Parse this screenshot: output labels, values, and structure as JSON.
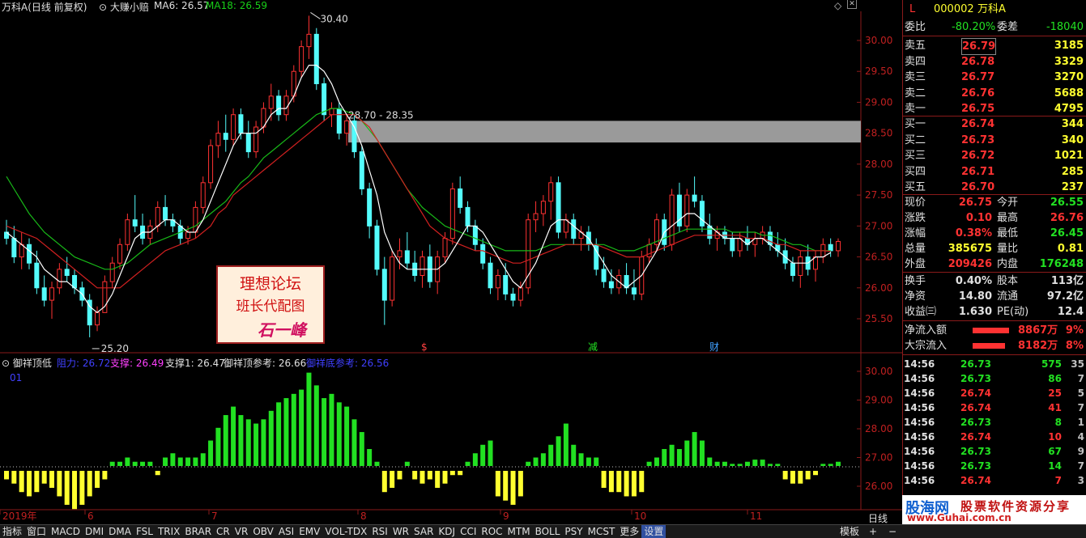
{
  "chart_header": {
    "title": "万科A(日线 前复权)",
    "indicator_name": "大赚小赔",
    "ma6": "MA6: 26.57",
    "ma18": "MA18: 26.59"
  },
  "price_axis": [
    "30.00",
    "29.50",
    "29.00",
    "28.50",
    "28.00",
    "27.50",
    "27.00",
    "26.50",
    "26.00",
    "25.50"
  ],
  "price_annotations": {
    "high": "30.40",
    "low": "25.20",
    "zone": "28.70 - 28.35"
  },
  "markers": [
    "$",
    "减",
    "财"
  ],
  "lower_header": {
    "name": "御祥顶低",
    "r": "阻力: 26.72",
    "s": "支撑: 26.49",
    "s1": "支撑1: 26.47",
    "top": "御祥顶参考: 26.66",
    "bottom": "御祥底参考: 26.56",
    "tag": "01"
  },
  "lower_axis": [
    "30.00",
    "29.00",
    "28.00",
    "27.00",
    "26.00"
  ],
  "time_axis": [
    "2019年",
    "6",
    "7",
    "8",
    "9",
    "10",
    "11"
  ],
  "watermark": {
    "line1": "理想论坛",
    "line2": "班长代配图",
    "line3": "石一峰"
  },
  "colors": {
    "up": "#ff3232",
    "down": "#54fcfc",
    "ma_white": "#ffffff",
    "ma_red": "#d02020",
    "ma_green": "#18b818",
    "bar_green": "#22e022",
    "bar_yellow": "#ffff30",
    "yellow": "#ffff30"
  },
  "chart_data": {
    "type": "candlestick",
    "ohlc": [
      [
        26.9,
        27.1,
        26.7,
        26.8
      ],
      [
        26.8,
        27.0,
        26.4,
        26.5
      ],
      [
        26.5,
        26.9,
        26.3,
        26.7
      ],
      [
        26.7,
        26.8,
        26.3,
        26.4
      ],
      [
        26.4,
        26.6,
        25.9,
        26.0
      ],
      [
        26.0,
        26.2,
        25.7,
        25.8
      ],
      [
        25.8,
        26.1,
        25.5,
        26.0
      ],
      [
        26.0,
        26.4,
        25.9,
        26.3
      ],
      [
        26.3,
        26.5,
        26.1,
        26.2
      ],
      [
        26.2,
        26.3,
        25.9,
        26.0
      ],
      [
        26.0,
        26.1,
        25.7,
        25.8
      ],
      [
        25.8,
        25.9,
        25.2,
        25.4
      ],
      [
        25.4,
        25.7,
        25.3,
        25.6
      ],
      [
        25.6,
        26.2,
        25.6,
        26.1
      ],
      [
        26.1,
        26.5,
        26.0,
        26.4
      ],
      [
        26.4,
        26.8,
        26.3,
        26.7
      ],
      [
        26.7,
        27.2,
        26.6,
        27.1
      ],
      [
        27.1,
        27.5,
        26.9,
        27.0
      ],
      [
        27.0,
        27.2,
        26.7,
        26.8
      ],
      [
        26.8,
        27.1,
        26.7,
        27.0
      ],
      [
        27.0,
        27.4,
        26.9,
        27.3
      ],
      [
        27.3,
        27.5,
        27.0,
        27.1
      ],
      [
        27.1,
        27.2,
        26.9,
        27.0
      ],
      [
        27.0,
        27.1,
        26.7,
        26.8
      ],
      [
        26.8,
        27.0,
        26.7,
        26.9
      ],
      [
        26.9,
        27.4,
        26.8,
        27.3
      ],
      [
        27.3,
        27.8,
        27.2,
        27.7
      ],
      [
        27.7,
        28.4,
        27.6,
        28.3
      ],
      [
        28.3,
        28.7,
        28.1,
        28.5
      ],
      [
        28.5,
        28.8,
        28.2,
        28.4
      ],
      [
        28.4,
        28.9,
        28.3,
        28.8
      ],
      [
        28.8,
        28.9,
        28.4,
        28.5
      ],
      [
        28.5,
        28.7,
        28.1,
        28.2
      ],
      [
        28.2,
        28.7,
        28.1,
        28.6
      ],
      [
        28.6,
        29.0,
        28.5,
        28.9
      ],
      [
        28.9,
        29.3,
        28.7,
        29.1
      ],
      [
        29.1,
        29.2,
        28.7,
        28.8
      ],
      [
        28.8,
        29.2,
        28.7,
        29.1
      ],
      [
        29.1,
        29.6,
        29.0,
        29.5
      ],
      [
        29.5,
        30.0,
        29.4,
        29.9
      ],
      [
        29.9,
        30.4,
        29.7,
        30.1
      ],
      [
        30.1,
        30.2,
        29.2,
        29.3
      ],
      [
        29.3,
        29.4,
        28.7,
        28.8
      ],
      [
        28.8,
        29.0,
        28.6,
        28.9
      ],
      [
        28.9,
        29.0,
        28.4,
        28.5
      ],
      [
        28.5,
        28.8,
        28.3,
        28.7
      ],
      [
        28.7,
        28.8,
        28.1,
        28.2
      ],
      [
        28.2,
        28.3,
        27.5,
        27.6
      ],
      [
        27.6,
        27.7,
        26.8,
        27.0
      ],
      [
        27.0,
        27.1,
        26.2,
        26.3
      ],
      [
        26.3,
        26.5,
        25.4,
        25.8
      ],
      [
        25.8,
        26.6,
        25.7,
        26.5
      ],
      [
        26.5,
        26.8,
        26.3,
        26.6
      ],
      [
        26.6,
        26.9,
        26.3,
        26.4
      ],
      [
        26.4,
        26.6,
        26.1,
        26.2
      ],
      [
        26.2,
        26.6,
        26.0,
        26.5
      ],
      [
        26.5,
        26.7,
        26.0,
        26.1
      ],
      [
        26.1,
        26.6,
        25.9,
        26.5
      ],
      [
        26.5,
        26.9,
        26.4,
        26.8
      ],
      [
        26.8,
        27.7,
        26.7,
        27.6
      ],
      [
        27.6,
        27.8,
        27.2,
        27.3
      ],
      [
        27.3,
        27.4,
        26.9,
        27.0
      ],
      [
        27.0,
        27.1,
        26.6,
        26.7
      ],
      [
        26.7,
        26.8,
        26.3,
        26.4
      ],
      [
        26.4,
        26.5,
        25.9,
        26.0
      ],
      [
        26.0,
        26.3,
        25.8,
        26.2
      ],
      [
        26.2,
        26.4,
        25.8,
        25.9
      ],
      [
        25.9,
        26.0,
        25.7,
        25.8
      ],
      [
        25.8,
        26.1,
        25.7,
        26.0
      ],
      [
        26.0,
        27.2,
        25.9,
        27.1
      ],
      [
        27.1,
        27.4,
        26.9,
        27.2
      ],
      [
        27.2,
        27.5,
        27.0,
        27.4
      ],
      [
        27.4,
        27.8,
        27.1,
        27.7
      ],
      [
        27.7,
        27.8,
        26.8,
        26.9
      ],
      [
        26.9,
        27.2,
        26.8,
        27.1
      ],
      [
        27.1,
        27.2,
        26.7,
        26.8
      ],
      [
        26.8,
        27.0,
        26.6,
        26.9
      ],
      [
        26.9,
        27.0,
        26.6,
        26.7
      ],
      [
        26.7,
        26.8,
        26.2,
        26.3
      ],
      [
        26.3,
        26.5,
        26.0,
        26.1
      ],
      [
        26.1,
        26.3,
        25.9,
        26.0
      ],
      [
        26.0,
        26.3,
        25.9,
        26.2
      ],
      [
        26.2,
        26.4,
        25.9,
        26.0
      ],
      [
        26.0,
        26.3,
        25.8,
        25.9
      ],
      [
        25.9,
        26.6,
        25.8,
        26.5
      ],
      [
        26.5,
        26.8,
        26.4,
        26.7
      ],
      [
        26.7,
        27.2,
        26.6,
        27.1
      ],
      [
        27.1,
        27.2,
        26.6,
        26.7
      ],
      [
        26.7,
        27.6,
        26.6,
        27.5
      ],
      [
        27.5,
        27.7,
        26.9,
        27.0
      ],
      [
        27.0,
        27.6,
        26.9,
        27.5
      ],
      [
        27.5,
        27.8,
        27.3,
        27.4
      ],
      [
        27.4,
        27.5,
        26.9,
        27.0
      ],
      [
        27.0,
        27.2,
        26.7,
        26.8
      ],
      [
        26.8,
        27.0,
        26.6,
        26.9
      ],
      [
        26.9,
        27.0,
        26.7,
        26.8
      ],
      [
        26.8,
        26.9,
        26.5,
        26.6
      ],
      [
        26.6,
        26.9,
        26.5,
        26.8
      ],
      [
        26.8,
        27.0,
        26.6,
        26.7
      ],
      [
        26.7,
        26.9,
        26.5,
        26.8
      ],
      [
        26.8,
        27.0,
        26.7,
        26.9
      ],
      [
        26.9,
        27.0,
        26.6,
        26.7
      ],
      [
        26.7,
        26.9,
        26.5,
        26.6
      ],
      [
        26.6,
        26.8,
        26.3,
        26.4
      ],
      [
        26.4,
        26.5,
        26.1,
        26.2
      ],
      [
        26.2,
        26.6,
        26.0,
        26.5
      ],
      [
        26.5,
        26.7,
        26.2,
        26.3
      ],
      [
        26.3,
        26.6,
        26.1,
        26.5
      ],
      [
        26.5,
        26.8,
        26.4,
        26.7
      ],
      [
        26.7,
        26.8,
        26.5,
        26.6
      ],
      [
        26.6,
        26.8,
        26.5,
        26.75
      ]
    ],
    "ma_white": [
      26.9,
      26.8,
      26.7,
      26.6,
      26.5,
      26.3,
      26.2,
      26.1,
      26.1,
      26.0,
      25.9,
      25.7,
      25.6,
      25.7,
      25.9,
      26.2,
      26.5,
      26.8,
      26.9,
      26.9,
      27.0,
      27.1,
      27.1,
      27.0,
      26.9,
      26.9,
      27.1,
      27.4,
      27.7,
      28.0,
      28.3,
      28.5,
      28.5,
      28.5,
      28.6,
      28.8,
      28.9,
      28.9,
      29.1,
      29.4,
      29.6,
      29.6,
      29.5,
      29.3,
      29.0,
      28.8,
      28.6,
      28.3,
      27.9,
      27.5,
      26.9,
      26.6,
      26.4,
      26.3,
      26.3,
      26.3,
      26.3,
      26.3,
      26.4,
      26.6,
      26.8,
      27.0,
      27.0,
      26.9,
      26.7,
      26.5,
      26.3,
      26.1,
      26.0,
      26.2,
      26.4,
      26.7,
      27.0,
      27.1,
      27.1,
      27.0,
      26.9,
      26.8,
      26.6,
      26.4,
      26.2,
      26.1,
      26.0,
      26.1,
      26.2,
      26.4,
      26.6,
      26.9,
      27.0,
      27.1,
      27.2,
      27.2,
      27.1,
      27.0,
      26.9,
      26.8,
      26.8,
      26.8,
      26.7,
      26.8,
      26.8,
      26.7,
      26.6,
      26.5,
      26.4,
      26.4,
      26.4,
      26.5,
      26.5,
      26.57
    ],
    "ma_red": [
      27.0,
      26.95,
      26.9,
      26.85,
      26.8,
      26.7,
      26.6,
      26.5,
      26.4,
      26.3,
      26.2,
      26.1,
      26.0,
      26.0,
      26.0,
      26.0,
      26.1,
      26.2,
      26.3,
      26.4,
      26.5,
      26.6,
      26.65,
      26.7,
      26.75,
      26.8,
      26.9,
      27.0,
      27.2,
      27.3,
      27.5,
      27.6,
      27.7,
      27.8,
      27.9,
      28.0,
      28.1,
      28.2,
      28.3,
      28.4,
      28.5,
      28.6,
      28.7,
      28.8,
      28.8,
      28.8,
      28.8,
      28.7,
      28.6,
      28.4,
      28.2,
      28.0,
      27.8,
      27.6,
      27.4,
      27.2,
      27.0,
      26.9,
      26.8,
      26.75,
      26.7,
      26.65,
      26.6,
      26.6,
      26.55,
      26.5,
      26.45,
      26.4,
      26.4,
      26.45,
      26.5,
      26.55,
      26.6,
      26.65,
      26.7,
      26.7,
      26.7,
      26.7,
      26.7,
      26.65,
      26.6,
      26.55,
      26.5,
      26.5,
      26.5,
      26.55,
      26.6,
      26.65,
      26.7,
      26.75,
      26.8,
      26.85,
      26.85,
      26.85,
      26.85,
      26.85,
      26.85,
      26.85,
      26.8,
      26.8,
      26.8,
      26.75,
      26.7,
      26.7,
      26.65,
      26.6,
      26.6,
      26.6,
      26.6,
      26.59
    ],
    "ma_green": [
      27.8,
      27.6,
      27.4,
      27.2,
      27.05,
      26.9,
      26.8,
      26.7,
      26.6,
      26.5,
      26.45,
      26.4,
      26.35,
      26.3,
      26.3,
      26.35,
      26.4,
      26.5,
      26.6,
      26.7,
      26.75,
      26.8,
      26.85,
      26.9,
      26.95,
      27.0,
      27.1,
      27.2,
      27.3,
      27.4,
      27.55,
      27.7,
      27.8,
      27.95,
      28.1,
      28.2,
      28.3,
      28.4,
      28.5,
      28.6,
      28.7,
      28.8,
      28.85,
      28.9,
      28.9,
      28.85,
      28.8,
      28.7,
      28.55,
      28.4,
      28.2,
      28.0,
      27.8,
      27.6,
      27.45,
      27.3,
      27.2,
      27.1,
      27.0,
      26.95,
      26.9,
      26.85,
      26.8,
      26.75,
      26.7,
      26.65,
      26.6,
      26.6,
      26.6,
      26.6,
      26.6,
      26.65,
      26.7,
      26.7,
      26.7,
      26.7,
      26.7,
      26.7,
      26.7,
      26.7,
      26.65,
      26.6,
      26.6,
      26.6,
      26.65,
      26.7,
      26.75,
      26.8,
      26.85,
      26.9,
      26.95,
      26.95,
      26.95,
      26.95,
      26.95,
      26.95,
      26.9,
      26.9,
      26.9,
      26.9,
      26.85,
      26.85,
      26.8,
      26.75,
      26.7,
      26.7,
      26.65,
      26.6,
      26.6,
      26.6
    ],
    "osc": [
      -0.2,
      -0.3,
      -0.5,
      -0.6,
      -0.5,
      -0.3,
      -0.4,
      -0.6,
      -0.8,
      -0.9,
      -0.8,
      -0.6,
      -0.4,
      -0.2,
      0.1,
      0.1,
      0.2,
      0.1,
      0.1,
      0.1,
      -0.1,
      0.2,
      0.3,
      0.2,
      0.2,
      0.2,
      0.3,
      0.6,
      0.9,
      1.2,
      1.4,
      1.2,
      1.1,
      1.0,
      1.1,
      1.3,
      1.5,
      1.6,
      1.7,
      1.8,
      2.2,
      1.9,
      1.6,
      1.7,
      1.5,
      1.4,
      1.1,
      0.8,
      0.4,
      0.1,
      -0.5,
      -0.4,
      -0.2,
      0.1,
      -0.2,
      -0.3,
      -0.2,
      -0.4,
      -0.3,
      -0.1,
      -0.1,
      0.1,
      0.3,
      0.5,
      0.6,
      -0.6,
      -0.7,
      -0.8,
      -0.6,
      0.1,
      0.2,
      0.3,
      0.5,
      0.7,
      1.0,
      0.5,
      0.3,
      0.2,
      0.2,
      -0.4,
      -0.5,
      -0.5,
      -0.6,
      -0.6,
      -0.5,
      0.1,
      0.2,
      0.4,
      0.5,
      0.4,
      0.6,
      0.8,
      0.6,
      0.2,
      0.1,
      0.1,
      0.05,
      0.05,
      0.1,
      0.15,
      0.15,
      0.05,
      0.05,
      -0.2,
      -0.3,
      -0.3,
      -0.2,
      -0.1,
      0.05,
      0.05,
      0.1
    ]
  },
  "quote": {
    "code_label": "000002",
    "name": "万科A",
    "flag1": "L",
    "flag2": "R\n300",
    "weibi_label": "委比",
    "weibi": "-80.20%",
    "weicha_label": "委差",
    "weicha": "-18040",
    "sells": [
      {
        "label": "卖五",
        "price": "26.79",
        "vol": "3185"
      },
      {
        "label": "卖四",
        "price": "26.78",
        "vol": "3329"
      },
      {
        "label": "卖三",
        "price": "26.77",
        "vol": "3270"
      },
      {
        "label": "卖二",
        "price": "26.76",
        "vol": "5688"
      },
      {
        "label": "卖一",
        "price": "26.75",
        "vol": "4795"
      }
    ],
    "buys": [
      {
        "label": "买一",
        "price": "26.74",
        "vol": "344"
      },
      {
        "label": "买二",
        "price": "26.73",
        "vol": "340"
      },
      {
        "label": "买三",
        "price": "26.72",
        "vol": "1021"
      },
      {
        "label": "买四",
        "price": "26.71",
        "vol": "285"
      },
      {
        "label": "买五",
        "price": "26.70",
        "vol": "237"
      }
    ],
    "stats": [
      {
        "l1": "现价",
        "v1": "26.75",
        "c1": "red",
        "l2": "今开",
        "v2": "26.55",
        "c2": "green"
      },
      {
        "l1": "涨跌",
        "v1": "0.10",
        "c1": "red",
        "l2": "最高",
        "v2": "26.76",
        "c2": "red"
      },
      {
        "l1": "涨幅",
        "v1": "0.38%",
        "c1": "red",
        "l2": "最低",
        "v2": "26.45",
        "c2": "green"
      },
      {
        "l1": "总量",
        "v1": "385675",
        "c1": "yellow",
        "l2": "量比",
        "v2": "0.81",
        "c2": "yellow"
      },
      {
        "l1": "外盘",
        "v1": "209426",
        "c1": "red",
        "l2": "内盘",
        "v2": "176248",
        "c2": "green"
      },
      {
        "l1": "换手",
        "v1": "0.40%",
        "c1": "white",
        "l2": "股本",
        "v2": "113亿",
        "c2": "white"
      },
      {
        "l1": "净资",
        "v1": "14.80",
        "c1": "white",
        "l2": "流通",
        "v2": "97.2亿",
        "c2": "white"
      },
      {
        "l1": "收益㈢",
        "v1": "1.630",
        "c1": "white",
        "l2": "PE(动)",
        "v2": "12.4",
        "c2": "white"
      }
    ],
    "flows": [
      {
        "label": "净流入额",
        "value": "8867万",
        "pct": "9%",
        "bar": 0.9
      },
      {
        "label": "大宗流入",
        "value": "8182万",
        "pct": "8%",
        "bar": 0.8
      }
    ]
  },
  "ticks": [
    {
      "t": "14:56",
      "p": "26.73",
      "v": "575",
      "n": "35",
      "c": "green"
    },
    {
      "t": "14:56",
      "p": "26.73",
      "v": "86",
      "n": "7",
      "c": "green"
    },
    {
      "t": "14:56",
      "p": "26.74",
      "v": "25",
      "n": "5",
      "c": "red"
    },
    {
      "t": "14:56",
      "p": "26.74",
      "v": "41",
      "n": "7",
      "c": "red"
    },
    {
      "t": "14:56",
      "p": "26.73",
      "v": "8",
      "n": "1",
      "c": "green"
    },
    {
      "t": "14:56",
      "p": "26.74",
      "v": "10",
      "n": "4",
      "c": "red"
    },
    {
      "t": "14:56",
      "p": "26.73",
      "v": "67",
      "n": "9",
      "c": "green"
    },
    {
      "t": "14:56",
      "p": "26.73",
      "v": "14",
      "n": "7",
      "c": "green"
    },
    {
      "t": "14:56",
      "p": "26.74",
      "v": "7",
      "n": "3",
      "c": "red"
    }
  ],
  "bottom_tabs": [
    "指标",
    "窗口",
    "MACD",
    "DMI",
    "DMA",
    "FSL",
    "TRIX",
    "BRAR",
    "CR",
    "VR",
    "OBV",
    "ASI",
    "EMV",
    "VOL-TDX",
    "RSI",
    "WR",
    "SAR",
    "KDJ",
    "CCI",
    "ROC",
    "MTM",
    "BOLL",
    "PSY",
    "MCST",
    "更多",
    "设置"
  ],
  "bottom_right": {
    "template": "模板",
    "plus": "+",
    "minus": "−",
    "period": "日线"
  },
  "brand": {
    "name": "股海网",
    "slogan": "股票软件资源分享",
    "url": "www.Guhai.com.cn"
  }
}
